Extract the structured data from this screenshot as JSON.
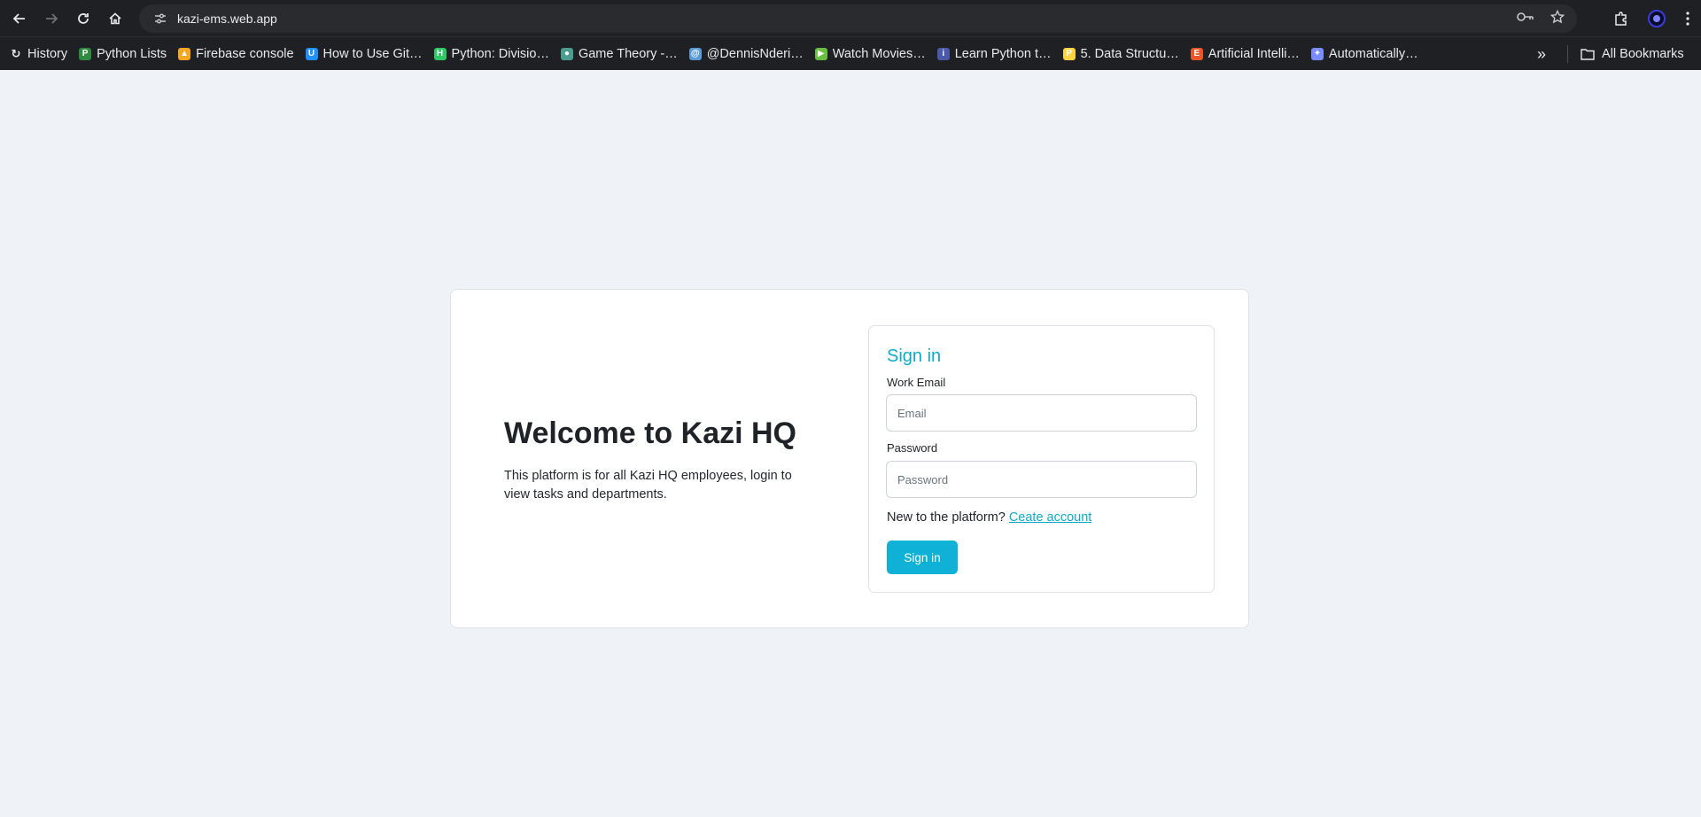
{
  "browser": {
    "url": "kazi-ems.web.app",
    "bookmarks": [
      {
        "label": "History",
        "icon": "history-icon",
        "color": "#e8eaed"
      },
      {
        "label": "Python Lists",
        "icon": "python-lists-favicon",
        "color": "#2e8b3e"
      },
      {
        "label": "Firebase console",
        "icon": "firebase-favicon",
        "color": "#f5a623"
      },
      {
        "label": "How to Use Git…",
        "icon": "git-guide-favicon",
        "color": "#1e90ff"
      },
      {
        "label": "Python: Divisio…",
        "icon": "hackerrank-favicon",
        "color": "#2ec866"
      },
      {
        "label": "Game Theory -…",
        "icon": "game-theory-favicon",
        "color": "#4a9d8f"
      },
      {
        "label": "@DennisNderi…",
        "icon": "dennis-favicon",
        "color": "#5b9bd5"
      },
      {
        "label": "Watch Movies…",
        "icon": "movies-favicon",
        "color": "#6abf40"
      },
      {
        "label": "Learn Python t…",
        "icon": "learn-python-favicon",
        "color": "#4a5aa8"
      },
      {
        "label": "5. Data Structu…",
        "icon": "python-docs-favicon",
        "color": "#ffd343"
      },
      {
        "label": "Artificial Intelli…",
        "icon": "edx-favicon",
        "color": "#e8562a"
      },
      {
        "label": "Automatically…",
        "icon": "automation-favicon",
        "color": "#7a8cff"
      }
    ],
    "all_bookmarks_label": "All Bookmarks"
  },
  "welcome": {
    "title": "Welcome to Kazi HQ",
    "text": "This platform is for all Kazi HQ employees, login to view tasks and departments."
  },
  "signin": {
    "title": "Sign in",
    "email_label": "Work Email",
    "email_placeholder": "Email",
    "email_value": "",
    "password_label": "Password",
    "password_placeholder": "Password",
    "password_value": "",
    "new_prompt": "New to the platform?",
    "create_link": "Ceate account",
    "button_label": "Sign in"
  },
  "colors": {
    "accent": "#0fb2d6",
    "page_bg": "#eff2f6"
  }
}
